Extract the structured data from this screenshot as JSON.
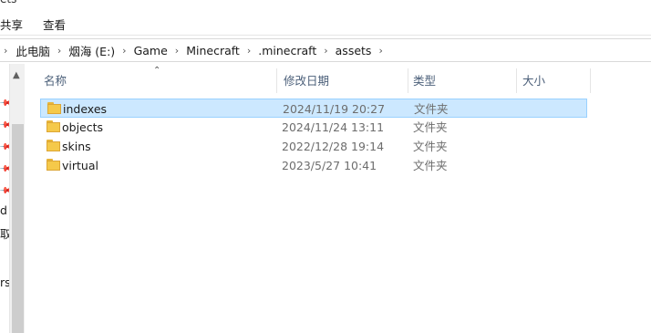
{
  "ribbon": {
    "top_fragment": "ets",
    "tabs": [
      {
        "label": "共享"
      },
      {
        "label": "查看"
      }
    ]
  },
  "address": {
    "crumbs": [
      "此电脑",
      "烟海 (E:)",
      "Game",
      "Minecraft",
      ".minecraft",
      "assets"
    ]
  },
  "nav": {
    "fragments": [
      "d",
      "取",
      "rs"
    ]
  },
  "columns": {
    "name": "名称",
    "date": "修改日期",
    "type": "类型",
    "size": "大小"
  },
  "files": [
    {
      "name": "indexes",
      "date": "2024/11/19 20:27",
      "type": "文件夹",
      "selected": true
    },
    {
      "name": "objects",
      "date": "2024/11/24 13:11",
      "type": "文件夹",
      "selected": false
    },
    {
      "name": "skins",
      "date": "2022/12/28 19:14",
      "type": "文件夹",
      "selected": false
    },
    {
      "name": "virtual",
      "date": "2023/5/27 10:41",
      "type": "文件夹",
      "selected": false
    }
  ],
  "colors": {
    "selection_bg": "#cce8ff",
    "selection_border": "#99d1ff",
    "header_text": "#4c607a",
    "folder_yellow": "#f5c94a"
  }
}
